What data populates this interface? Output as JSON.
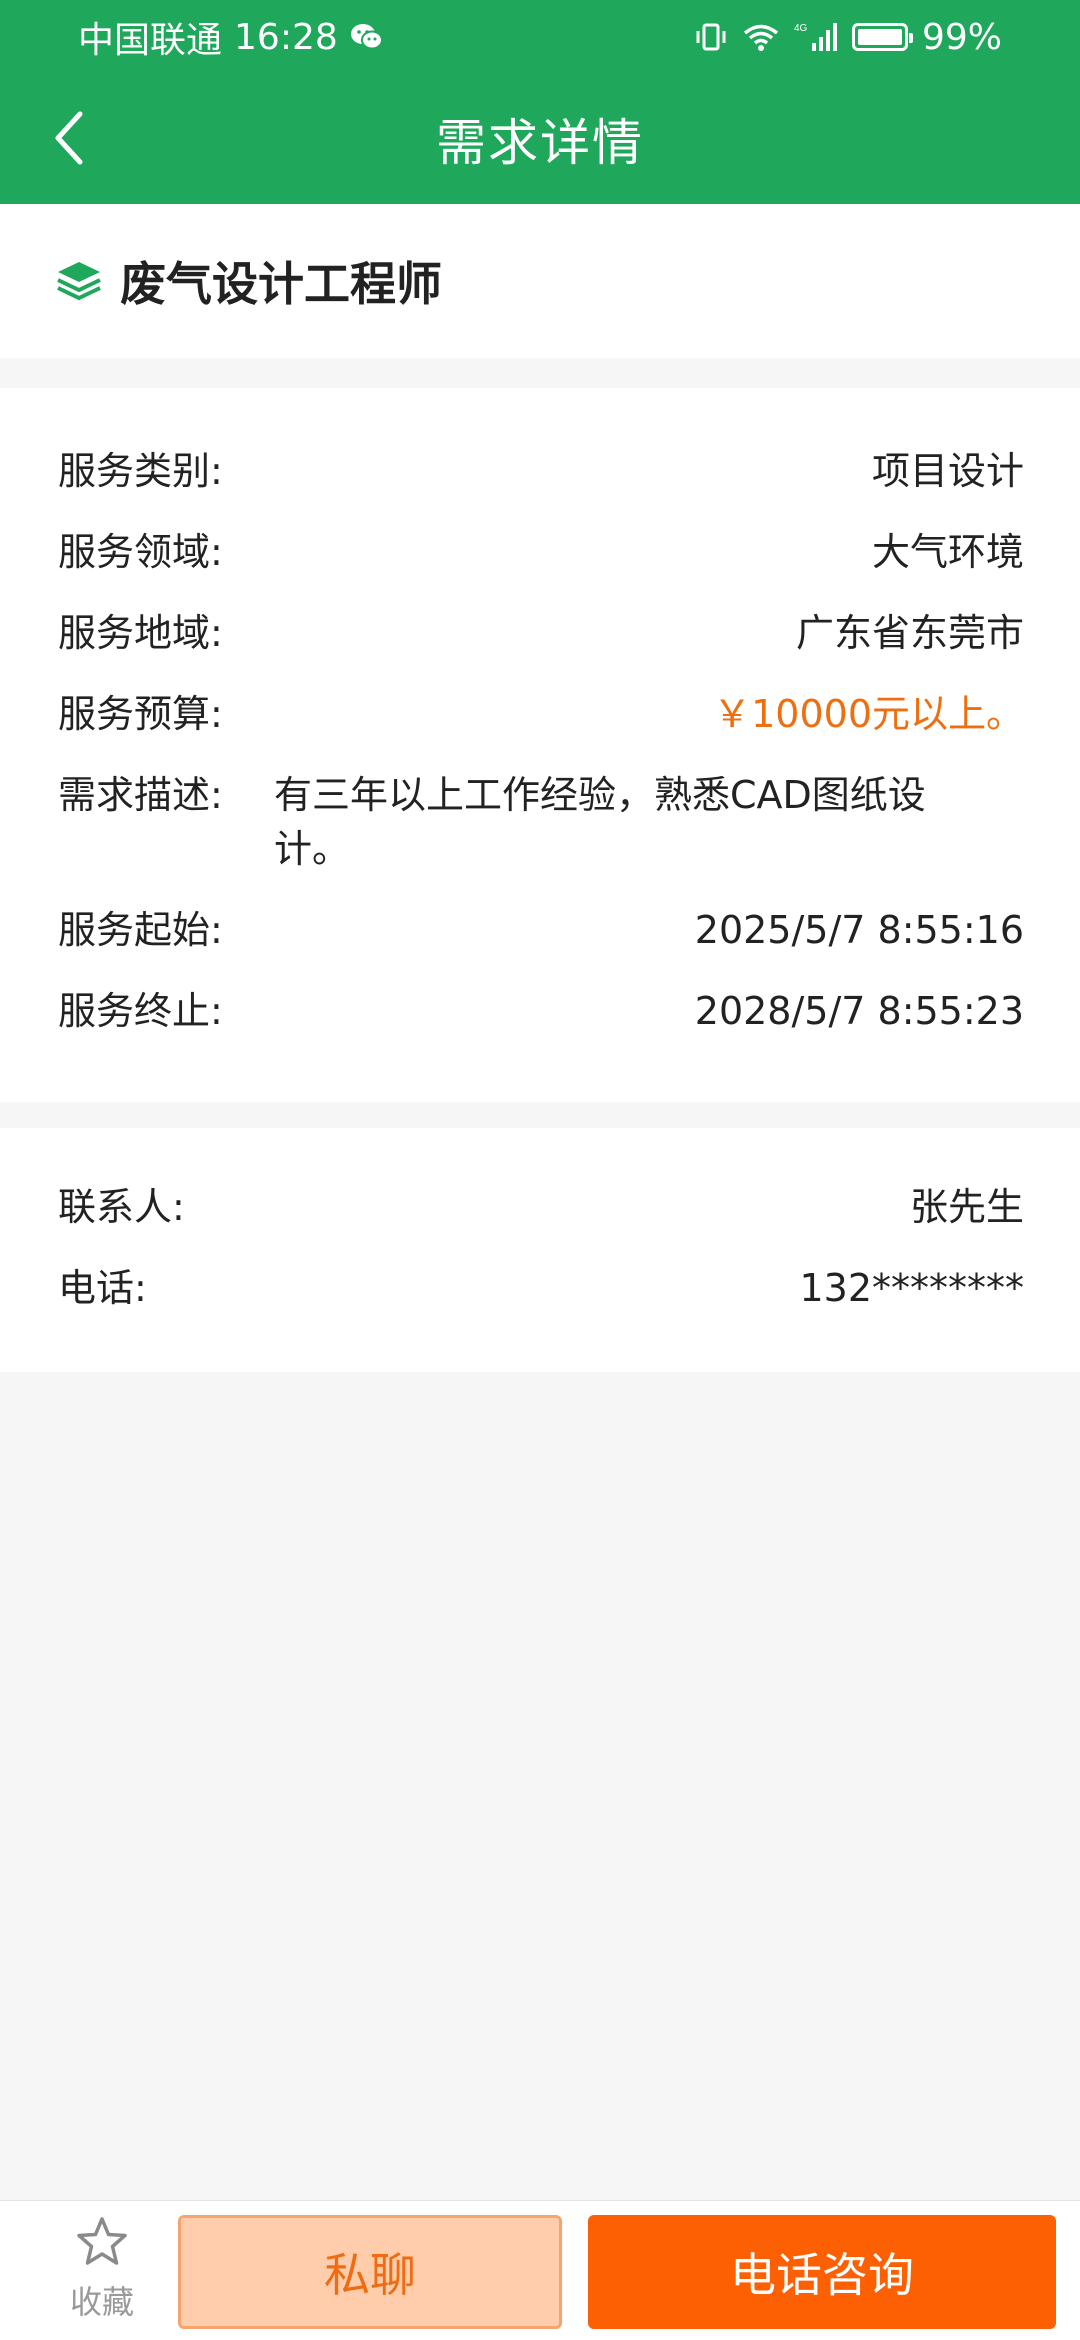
{
  "status_bar": {
    "carrier": "中国联通",
    "time": "16:28",
    "battery": "99%",
    "battery_level": 0.99,
    "network": "4G"
  },
  "nav": {
    "title": "需求详情"
  },
  "demand": {
    "title": "废气设计工程师",
    "fields": [
      {
        "label": "服务类别:",
        "value": "项目设计"
      },
      {
        "label": "服务领域:",
        "value": "大气环境"
      },
      {
        "label": "服务地域:",
        "value": "广东省东莞市"
      },
      {
        "label": "服务预算:",
        "value": "￥10000元以上。"
      },
      {
        "label": "需求描述:",
        "value": "有三年以上工作经验，熟悉CAD图纸设计。"
      },
      {
        "label": "服务起始:",
        "value": "2025/5/7 8:55:16"
      },
      {
        "label": "服务终止:",
        "value": "2028/5/7 8:55:23"
      }
    ]
  },
  "contact": {
    "fields": [
      {
        "label": "联系人:",
        "value": "张先生"
      },
      {
        "label": "电话:",
        "value": "132********"
      }
    ]
  },
  "bottom": {
    "favorite": "收藏",
    "chat": "私聊",
    "call": "电话咨询"
  },
  "colors": {
    "primary_green": "#1fa85b",
    "price_orange": "#ee6f12",
    "call_button": "#fd5f03",
    "chat_button_bg": "#ffccac"
  }
}
